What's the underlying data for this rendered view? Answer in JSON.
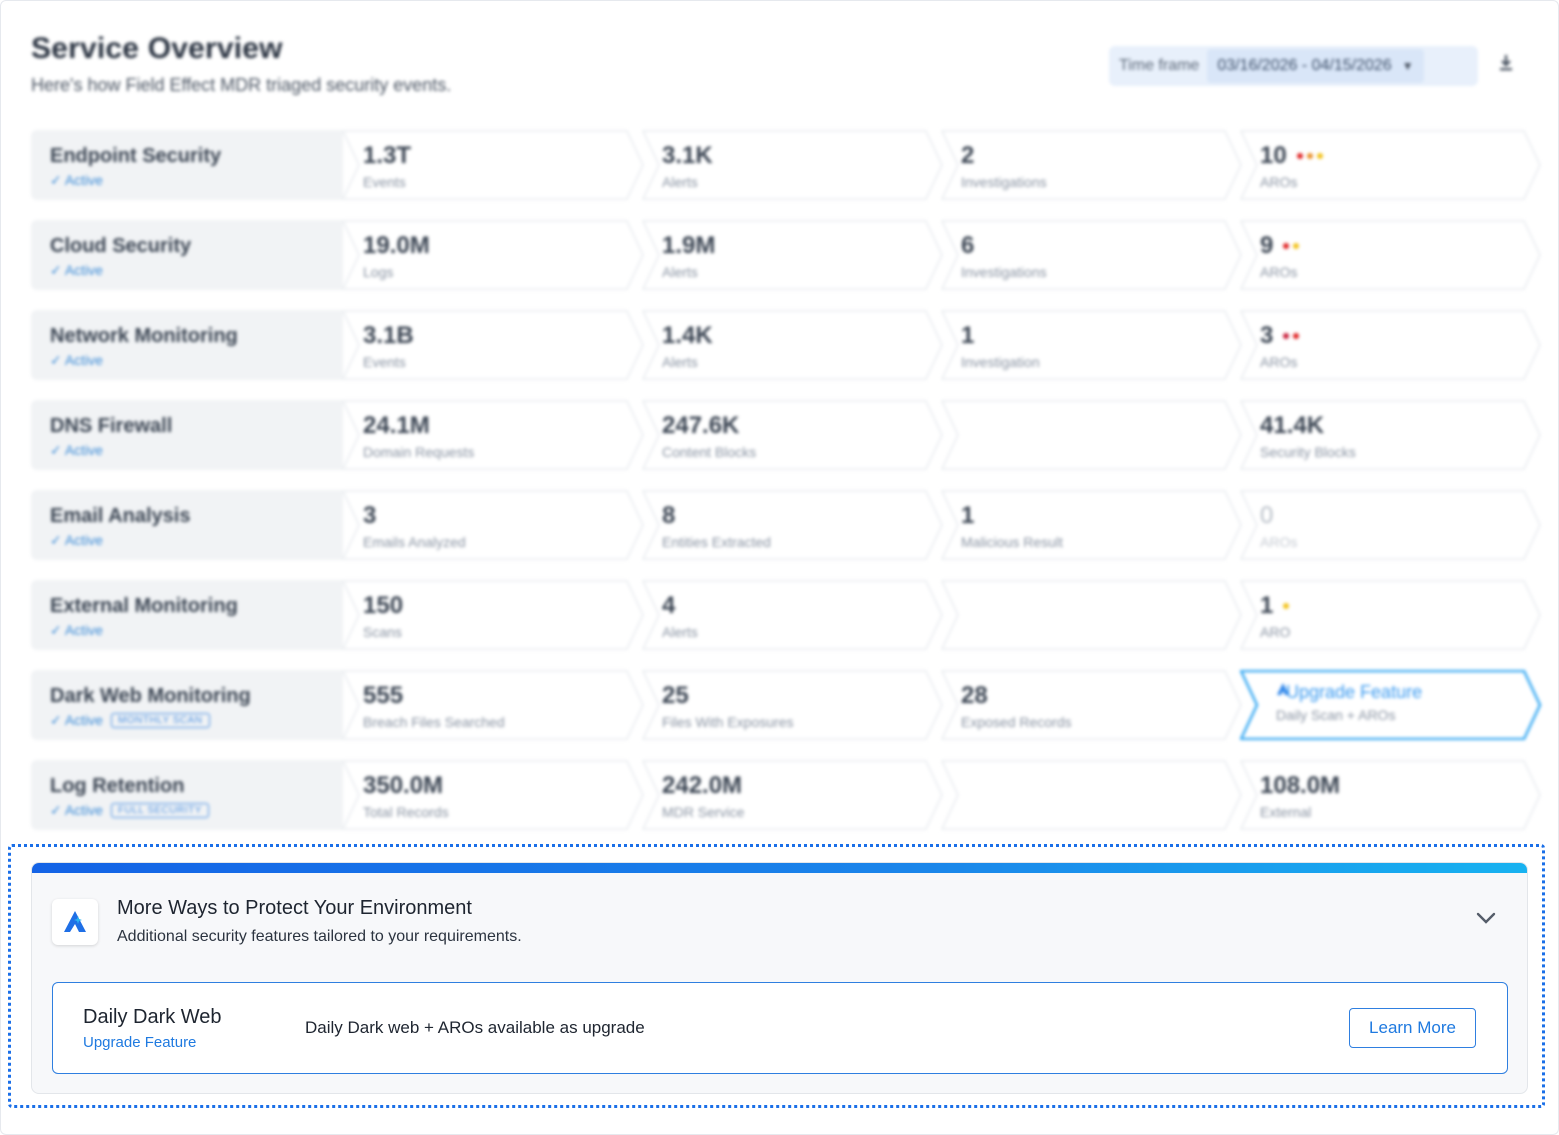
{
  "header": {
    "title": "Service Overview",
    "subtitle": "Here's how Field Effect MDR triaged security events.",
    "timeframe_label": "Time frame",
    "timeframe_value": "03/16/2026 - 04/15/2026",
    "download_icon": "download-icon"
  },
  "services": [
    {
      "name": "Endpoint Security",
      "status": "✓ Active",
      "tag": "",
      "metrics": [
        {
          "value": "1.3T",
          "label": "Events"
        },
        {
          "value": "3.1K",
          "label": "Alerts"
        },
        {
          "value": "2",
          "label": "Investigations"
        },
        {
          "value": "10",
          "label": "AROs",
          "dots": [
            "#e02424",
            "#e8902a",
            "#f2c21b"
          ]
        }
      ]
    },
    {
      "name": "Cloud Security",
      "status": "✓ Active",
      "tag": "",
      "metrics": [
        {
          "value": "19.0M",
          "label": "Logs"
        },
        {
          "value": "1.9M",
          "label": "Alerts"
        },
        {
          "value": "6",
          "label": "Investigations"
        },
        {
          "value": "9",
          "label": "AROs",
          "dots": [
            "#e02424",
            "#f2c21b"
          ]
        }
      ]
    },
    {
      "name": "Network Monitoring",
      "status": "✓ Active",
      "tag": "",
      "metrics": [
        {
          "value": "3.1B",
          "label": "Events"
        },
        {
          "value": "1.4K",
          "label": "Alerts"
        },
        {
          "value": "1",
          "label": "Investigation"
        },
        {
          "value": "3",
          "label": "AROs",
          "dots": [
            "#c81e3a",
            "#e02424"
          ]
        }
      ]
    },
    {
      "name": "DNS Firewall",
      "status": "✓ Active",
      "tag": "",
      "metrics": [
        {
          "value": "24.1M",
          "label": "Domain Requests"
        },
        {
          "value": "247.6K",
          "label": "Content Blocks"
        },
        {
          "value": "",
          "label": ""
        },
        {
          "value": "41.4K",
          "label": "Security Blocks"
        }
      ]
    },
    {
      "name": "Email Analysis",
      "status": "✓ Active",
      "tag": "",
      "metrics": [
        {
          "value": "3",
          "label": "Emails Analyzed"
        },
        {
          "value": "8",
          "label": "Entities Extracted"
        },
        {
          "value": "1",
          "label": "Malicious Result"
        },
        {
          "value": "0",
          "label": "AROs",
          "muted": true
        }
      ]
    },
    {
      "name": "External Monitoring",
      "status": "✓ Active",
      "tag": "",
      "metrics": [
        {
          "value": "150",
          "label": "Scans"
        },
        {
          "value": "4",
          "label": "Alerts"
        },
        {
          "value": "",
          "label": ""
        },
        {
          "value": "1",
          "label": "ARO",
          "dots": [
            "#f2c21b"
          ]
        }
      ]
    },
    {
      "name": "Dark Web Monitoring",
      "status": "✓ Active",
      "tag": "MONTHLY SCAN",
      "metrics": [
        {
          "value": "555",
          "label": "Breach Files Searched"
        },
        {
          "value": "25",
          "label": "Files With Exposures"
        },
        {
          "value": "28",
          "label": "Exposed Records"
        },
        {
          "value": "Upgrade Feature",
          "label": "Daily Scan + AROs",
          "upgrade": true
        }
      ]
    },
    {
      "name": "Log Retention",
      "status": "✓ Active",
      "tag": "FULL SECURITY",
      "metrics": [
        {
          "value": "350.0M",
          "label": "Total Records"
        },
        {
          "value": "242.0M",
          "label": "MDR Service"
        },
        {
          "value": "",
          "label": ""
        },
        {
          "value": "108.0M",
          "label": "External"
        }
      ]
    }
  ],
  "panel": {
    "title": "More Ways to Protect Your Environment",
    "subtitle": "Additional security features tailored to your requirements.",
    "card": {
      "title": "Daily Dark Web",
      "badge": "Upgrade Feature",
      "description": "Daily Dark web + AROs available as upgrade",
      "button": "Learn More"
    }
  },
  "colors": {
    "accent": "#1f7ae0",
    "gradient_start": "#1463e6",
    "gradient_end": "#18b2f0"
  }
}
